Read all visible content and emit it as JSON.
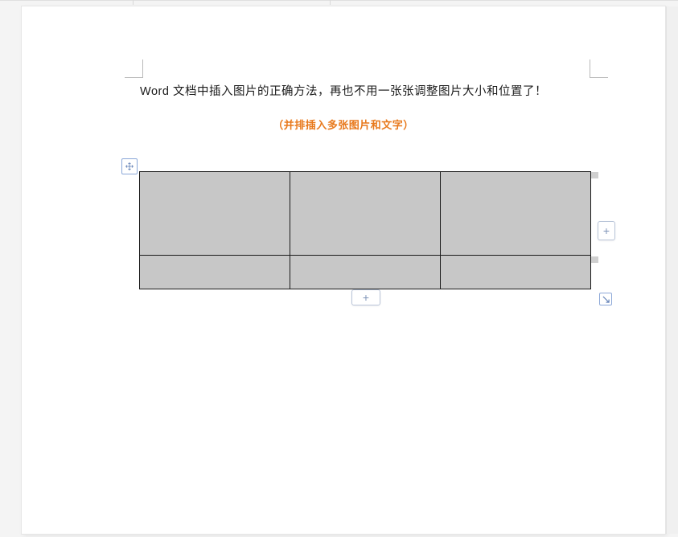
{
  "document": {
    "title": "Word 文档中插入图片的正确方法，再也不用一张张调整图片大小和位置了！",
    "subtitle": "（并排插入多张图片和文字）"
  },
  "table": {
    "rows": 2,
    "cols": 3,
    "cells": {
      "r1c1": "",
      "r1c2": "",
      "r1c3": "",
      "r2c1": "",
      "r2c2": "",
      "r2c3": ""
    }
  },
  "controls": {
    "move_handle": "move",
    "resize_handle": "resize",
    "add_column": "+",
    "add_row": "+"
  }
}
